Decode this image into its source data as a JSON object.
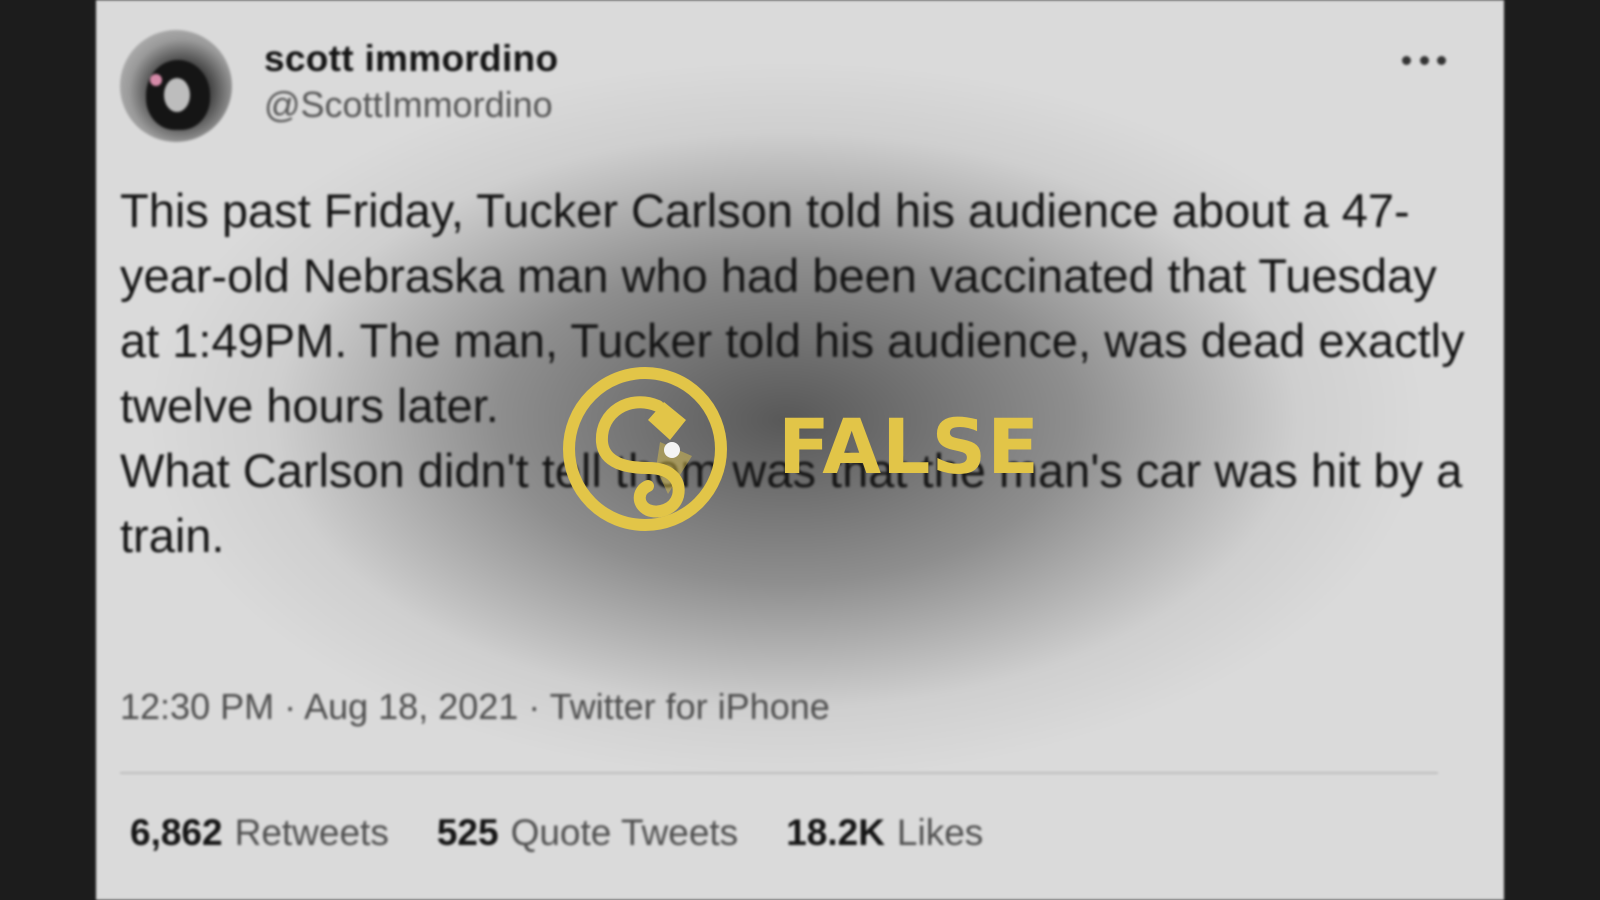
{
  "tweet": {
    "display_name": "scott immordino",
    "handle": "@ScottImmordino",
    "paragraphs": [
      "This past Friday, Tucker Carlson told his audience about a 47-year-old Nebraska man who had been vaccinated that Tuesday at 1:49PM. The man, Tucker told his audience, was dead exactly twelve hours later.",
      "What Carlson didn't tell them was that the man's car was hit by a train."
    ],
    "meta": "12:30 PM · Aug 18, 2021 · Twitter for iPhone",
    "stats": [
      {
        "count": "6,862",
        "label": "Retweets"
      },
      {
        "count": "525",
        "label": "Quote Tweets"
      },
      {
        "count": "18.2K",
        "label": "Likes"
      }
    ]
  },
  "overlay": {
    "rating": "FALSE",
    "rating_color": "#e2c548",
    "logo_icon": "fact-check-logo-icon"
  },
  "colors": {
    "background": "#1c1c1c",
    "card": "#d6d6d6",
    "text": "#151515",
    "muted": "#505050"
  }
}
